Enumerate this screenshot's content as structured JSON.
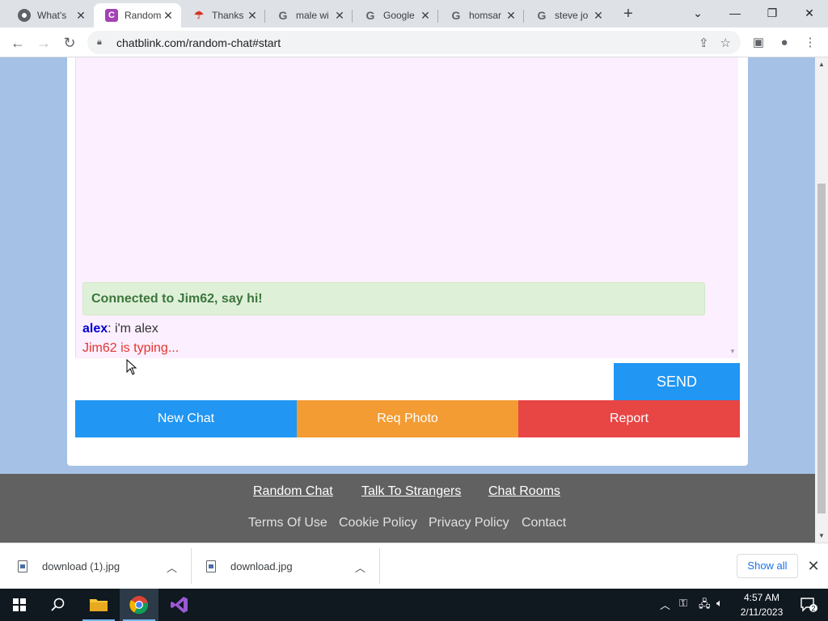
{
  "browser": {
    "tabs": [
      {
        "title": "What's",
        "icon": "chrome-icon"
      },
      {
        "title": "Random",
        "icon": "chatblink-icon",
        "active": true
      },
      {
        "title": "Thanks",
        "icon": "thanks-icon"
      },
      {
        "title": "male wi",
        "icon": "google-icon"
      },
      {
        "title": "Google",
        "icon": "google-icon"
      },
      {
        "title": "homsar",
        "icon": "google-icon"
      },
      {
        "title": "steve jo",
        "icon": "google-icon"
      }
    ],
    "url": "chatblink.com/random-chat#start"
  },
  "chat": {
    "banner": "Connected to Jim62, say hi!",
    "messages": [
      {
        "author": "alex",
        "separator": ":",
        "text": " i'm alex"
      }
    ],
    "typing": "Jim62 is typing...",
    "input_value": "",
    "send_label": "SEND",
    "actions": {
      "new_chat": "New Chat",
      "req_photo": "Req Photo",
      "report": "Report"
    }
  },
  "footer": {
    "primary_links": [
      "Random Chat",
      "Talk To Strangers",
      "Chat Rooms"
    ],
    "secondary_links": [
      "Terms Of Use",
      "Cookie Policy",
      "Privacy Policy",
      "Contact"
    ]
  },
  "downloads": {
    "items": [
      "download (1).jpg",
      "download.jpg"
    ],
    "show_all": "Show all"
  },
  "taskbar": {
    "time": "4:57 AM",
    "date": "2/11/2023",
    "notifications": "2"
  },
  "colors": {
    "send": "#2196f3",
    "new_chat": "#2196f3",
    "req_photo": "#f39c33",
    "report": "#e84545",
    "page_bg": "#a5c1e5",
    "footer_bg": "#616161"
  }
}
